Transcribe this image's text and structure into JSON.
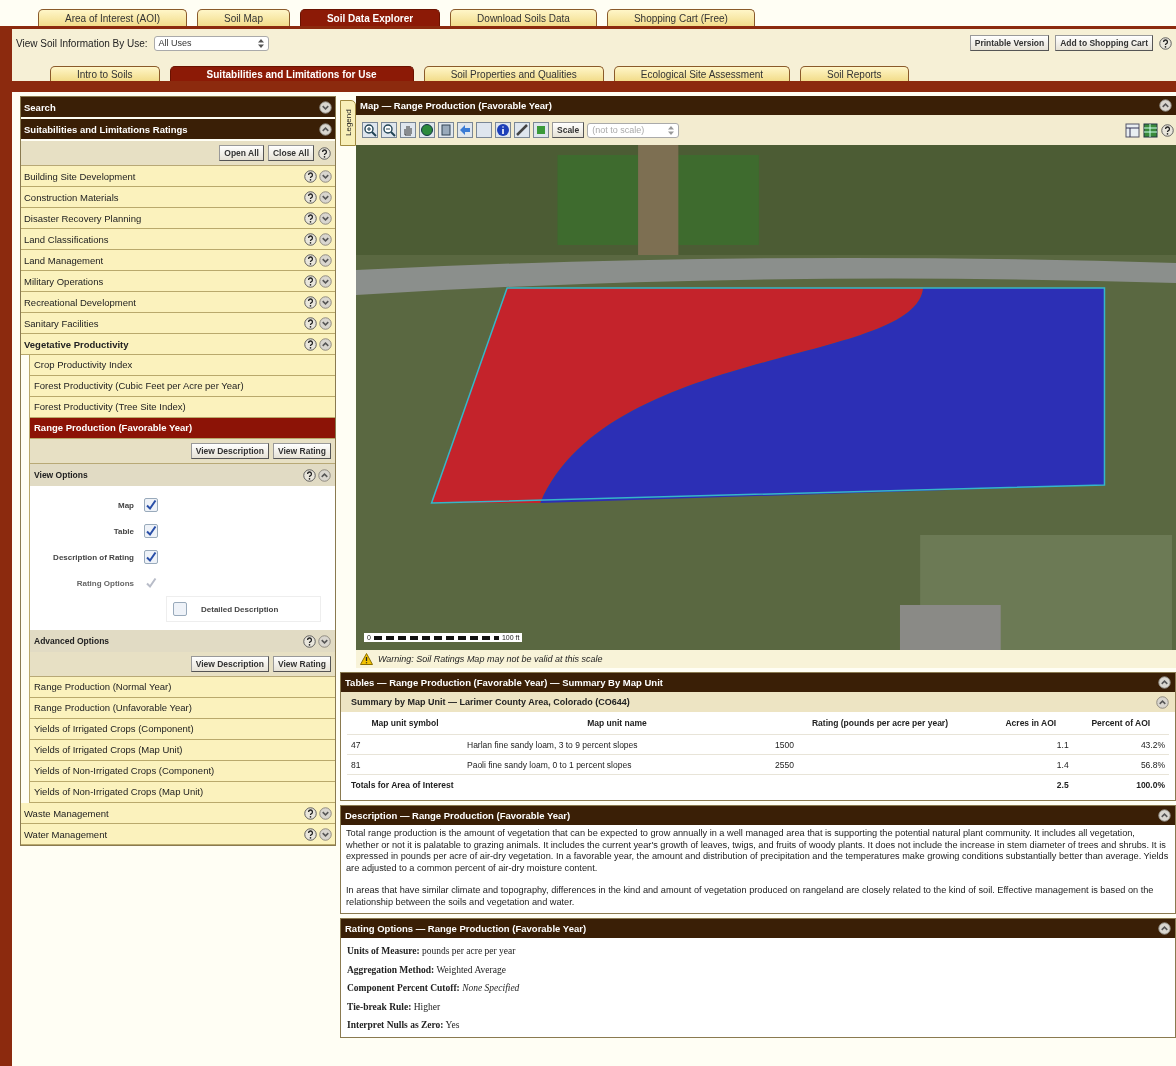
{
  "top_tabs": [
    {
      "label": "Area of Interest (AOI)",
      "selected": false
    },
    {
      "label": "Soil Map",
      "selected": false
    },
    {
      "label": "Soil Data Explorer",
      "selected": true
    },
    {
      "label": "Download Soils Data",
      "selected": false
    },
    {
      "label": "Shopping Cart (Free)",
      "selected": false
    }
  ],
  "use_bar": {
    "label": "View Soil Information By Use:",
    "select_value": "All Uses",
    "buttons": [
      "Printable Version",
      "Add to Shopping Cart"
    ]
  },
  "sub_tabs": [
    {
      "label": "Intro to Soils",
      "selected": false
    },
    {
      "label": "Suitabilities and Limitations for Use",
      "selected": true
    },
    {
      "label": "Soil Properties and Qualities",
      "selected": false
    },
    {
      "label": "Ecological Site Assessment",
      "selected": false
    },
    {
      "label": "Soil Reports",
      "selected": false
    }
  ],
  "sidebar": {
    "search": {
      "title": "Search",
      "expanded": false
    },
    "ratings": {
      "title": "Suitabilities and Limitations Ratings",
      "expanded": true,
      "buttons": [
        "Open All",
        "Close All"
      ]
    },
    "categories": [
      {
        "label": "Building Site Development",
        "expanded": false
      },
      {
        "label": "Construction Materials",
        "expanded": false
      },
      {
        "label": "Disaster Recovery Planning",
        "expanded": false
      },
      {
        "label": "Land Classifications",
        "expanded": false
      },
      {
        "label": "Land Management",
        "expanded": false
      },
      {
        "label": "Military Operations",
        "expanded": false
      },
      {
        "label": "Recreational Development",
        "expanded": false
      },
      {
        "label": "Sanitary Facilities",
        "expanded": false
      },
      {
        "label": "Vegetative Productivity",
        "expanded": true,
        "children": [
          {
            "label": "Crop Productivity Index",
            "selected": false
          },
          {
            "label": "Forest Productivity (Cubic Feet per Acre per Year)",
            "selected": false
          },
          {
            "label": "Forest Productivity (Tree Site Index)",
            "selected": false
          },
          {
            "label": "Range Production (Favorable Year)",
            "selected": true,
            "panel": {
              "buttons": [
                "View Description",
                "View Rating"
              ],
              "view_options": {
                "title": "View Options",
                "expanded": true,
                "options": [
                  {
                    "label": "Map",
                    "checked": true,
                    "disabled": false
                  },
                  {
                    "label": "Table",
                    "checked": true,
                    "disabled": false
                  },
                  {
                    "label": "Description of Rating",
                    "checked": true,
                    "disabled": false
                  },
                  {
                    "label": "Rating Options",
                    "checked": true,
                    "disabled": true
                  }
                ],
                "detail": {
                  "label": "Detailed Description",
                  "checked": false
                }
              },
              "advanced_options": {
                "title": "Advanced Options",
                "expanded": false
              },
              "bottom_buttons": [
                "View Description",
                "View Rating"
              ]
            }
          },
          {
            "label": "Range Production (Normal Year)",
            "selected": false
          },
          {
            "label": "Range Production (Unfavorable Year)",
            "selected": false
          },
          {
            "label": "Yields of Irrigated Crops (Component)",
            "selected": false
          },
          {
            "label": "Yields of Irrigated Crops (Map Unit)",
            "selected": false
          },
          {
            "label": "Yields of Non-Irrigated Crops (Component)",
            "selected": false
          },
          {
            "label": "Yields of Non-Irrigated Crops (Map Unit)",
            "selected": false
          }
        ]
      },
      {
        "label": "Waste Management",
        "expanded": false
      },
      {
        "label": "Water Management",
        "expanded": false
      }
    ]
  },
  "map": {
    "title": "Map — Range Production (Favorable Year)",
    "legend_tab": "Legend",
    "scale_button": "Scale",
    "scale_select": "(not to scale)",
    "scale_bar": [
      "0",
      "100 ft"
    ],
    "warning": "Warning: Soil Ratings Map may not be valid at this scale"
  },
  "tables": {
    "title": "Tables — Range Production (Favorable Year) — Summary By Map Unit",
    "subtitle": "Summary by Map Unit — Larimer County Area, Colorado (CO644)",
    "columns": [
      "Map unit symbol",
      "Map unit name",
      "Rating (pounds per acre per year)",
      "Acres in AOI",
      "Percent of AOI"
    ],
    "rows": [
      [
        "47",
        "Harlan fine sandy loam, 3 to 9 percent slopes",
        "1500",
        "1.1",
        "43.2%"
      ],
      [
        "81",
        "Paoli fine sandy loam, 0 to 1 percent slopes",
        "2550",
        "1.4",
        "56.8%"
      ]
    ],
    "totals": {
      "label": "Totals for Area of Interest",
      "acres": "2.5",
      "percent": "100.0%"
    }
  },
  "description": {
    "title": "Description — Range Production (Favorable Year)",
    "paragraphs": [
      "Total range production is the amount of vegetation that can be expected to grow annually in a well managed area that is supporting the potential natural plant community. It includes all vegetation, whether or not it is palatable to grazing animals. It includes the current year's growth of leaves, twigs, and fruits of woody plants. It does not include the increase in stem diameter of trees and shrubs. It is expressed in pounds per acre of air-dry vegetation. In a favorable year, the amount and distribution of precipitation and the temperatures make growing conditions substantially better than average. Yields are adjusted to a common percent of air-dry moisture content.",
      "In areas that have similar climate and topography, differences in the kind and amount of vegetation produced on rangeland are closely related to the kind of soil. Effective management is based on the relationship between the soils and vegetation and water."
    ]
  },
  "rating_options": {
    "title": "Rating Options — Range Production (Favorable Year)",
    "items": [
      {
        "label": "Units of Measure:",
        "value": "pounds per acre per year"
      },
      {
        "label": "Aggregation Method:",
        "value": "Weighted Average"
      },
      {
        "label": "Component Percent Cutoff:",
        "value": "*None Specified*"
      },
      {
        "label": "Tie-break Rule:",
        "value": "Higher"
      },
      {
        "label": "Interpret Nulls as Zero:",
        "value": "Yes"
      }
    ]
  }
}
